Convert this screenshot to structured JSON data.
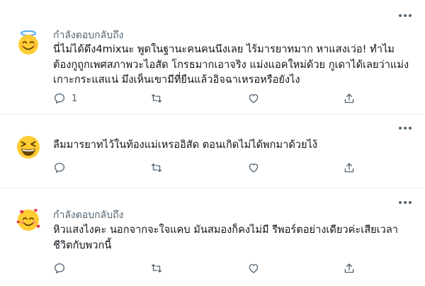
{
  "tweets": [
    {
      "reply_label": "กำลังตอบกลับถึง",
      "avatar_icon": "halo-smiling-face-emoji",
      "text": "นี่ไม่ได้ดึง4mixนะ พูดในฐานะคนคนนึงเลย ไร้มารยาทมาก หาแสงเว่อ! ทำไมต้องกูถูกเพศสภาพวะไอสัด โกรธมากเอาจริง แม่งแอคใหม่ด้วย กูเดาได้เลยว่าแม่งเกาะกระแสแน่ มึงเห็นเขามีที่ยืนแล้วอิจฉาเหรอหรือยังไง",
      "reply_count": "1"
    },
    {
      "avatar_icon": "grinning-squinting-face-emoji",
      "text": "ลืมมารยาทไว้ในท้องแม่เหรออิสัด ตอนเกิดไม่ได้พกมาด้วยไง้"
    },
    {
      "reply_label": "กำลังตอบกลับถึง",
      "avatar_icon": "smiling-face-with-hearts-emoji",
      "text": "หิวแสงไงคะ นอกจากจะใจแคบ มันสมองก็คงไม่มี รีพอร์ตอย่างเดียวค่ะเสียเวลาชีวิตกับพวกนี้"
    }
  ],
  "colors": {
    "text": "#0f1419",
    "secondary": "#536471",
    "divider": "#eff3f4",
    "emoji_yellow": "#ffcc33"
  }
}
